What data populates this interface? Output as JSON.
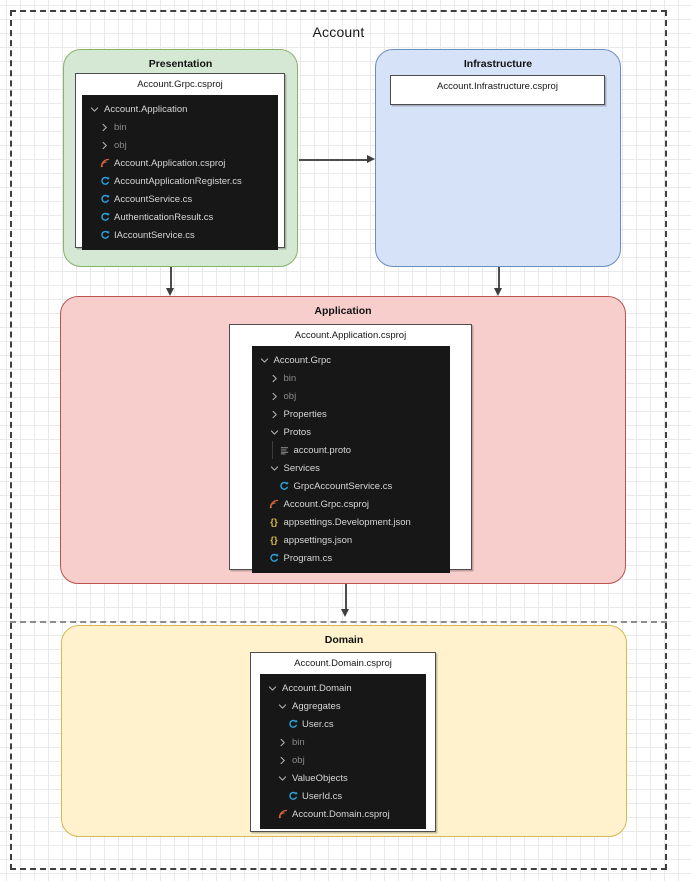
{
  "diagram": {
    "title": "Account",
    "layers": [
      {
        "id": "presentation",
        "label": "Presentation",
        "card_title": "Account.Grpc.csproj",
        "tree": [
          {
            "indent": 0,
            "icon": "chevron-down-icon",
            "label": "Account.Application",
            "dim": false
          },
          {
            "indent": 1,
            "icon": "chevron-right-icon",
            "label": "bin",
            "dim": true
          },
          {
            "indent": 1,
            "icon": "chevron-right-icon",
            "label": "obj",
            "dim": true
          },
          {
            "indent": 1,
            "icon": "csproj-icon",
            "label": "Account.Application.csproj",
            "dim": false
          },
          {
            "indent": 1,
            "icon": "csharp-icon",
            "label": "AccountApplicationRegister.cs",
            "dim": false
          },
          {
            "indent": 1,
            "icon": "csharp-icon",
            "label": "AccountService.cs",
            "dim": false
          },
          {
            "indent": 1,
            "icon": "csharp-icon",
            "label": "AuthenticationResult.cs",
            "dim": false
          },
          {
            "indent": 1,
            "icon": "csharp-icon",
            "label": "IAccountService.cs",
            "dim": false
          }
        ]
      },
      {
        "id": "infrastructure",
        "label": "Infrastructure",
        "card_title": "Account.Infrastructure.csproj",
        "tree": []
      },
      {
        "id": "application",
        "label": "Application",
        "card_title": "Account.Application.csproj",
        "tree": [
          {
            "indent": 0,
            "icon": "chevron-down-icon",
            "label": "Account.Grpc",
            "dim": false
          },
          {
            "indent": 1,
            "icon": "chevron-right-icon",
            "label": "bin",
            "dim": true
          },
          {
            "indent": 1,
            "icon": "chevron-right-icon",
            "label": "obj",
            "dim": true
          },
          {
            "indent": 1,
            "icon": "chevron-right-icon",
            "label": "Properties",
            "dim": false
          },
          {
            "indent": 1,
            "icon": "chevron-down-icon",
            "label": "Protos",
            "dim": false
          },
          {
            "indent": 2,
            "icon": "proto-icon",
            "label": "account.proto",
            "dim": false,
            "guide": true
          },
          {
            "indent": 1,
            "icon": "chevron-down-icon",
            "label": "Services",
            "dim": false
          },
          {
            "indent": 2,
            "icon": "csharp-icon",
            "label": "GrpcAccountService.cs",
            "dim": false
          },
          {
            "indent": 1,
            "icon": "csproj-icon",
            "label": "Account.Grpc.csproj",
            "dim": false
          },
          {
            "indent": 1,
            "icon": "json-icon",
            "label": "appsettings.Development.json",
            "dim": false
          },
          {
            "indent": 1,
            "icon": "json-icon",
            "label": "appsettings.json",
            "dim": false
          },
          {
            "indent": 1,
            "icon": "csharp-icon",
            "label": "Program.cs",
            "dim": false
          }
        ]
      },
      {
        "id": "domain",
        "label": "Domain",
        "card_title": "Account.Domain.csproj",
        "tree": [
          {
            "indent": 0,
            "icon": "chevron-down-icon",
            "label": "Account.Domain",
            "dim": false
          },
          {
            "indent": 1,
            "icon": "chevron-down-icon",
            "label": "Aggregates",
            "dim": false
          },
          {
            "indent": 2,
            "icon": "csharp-icon",
            "label": "User.cs",
            "dim": false
          },
          {
            "indent": 1,
            "icon": "chevron-right-icon",
            "label": "bin",
            "dim": true
          },
          {
            "indent": 1,
            "icon": "chevron-right-icon",
            "label": "obj",
            "dim": true
          },
          {
            "indent": 1,
            "icon": "chevron-down-icon",
            "label": "ValueObjects",
            "dim": false
          },
          {
            "indent": 2,
            "icon": "csharp-icon",
            "label": "UserId.cs",
            "dim": false
          },
          {
            "indent": 1,
            "icon": "csproj-icon",
            "label": "Account.Domain.csproj",
            "dim": false
          }
        ]
      }
    ],
    "connections": [
      {
        "from": "presentation",
        "to": "infrastructure",
        "direction": "right"
      },
      {
        "from": "presentation",
        "to": "application",
        "direction": "down"
      },
      {
        "from": "infrastructure",
        "to": "application",
        "direction": "down"
      },
      {
        "from": "application",
        "to": "domain",
        "direction": "down"
      }
    ],
    "colors": {
      "presentation_fill": "#d5e8d4",
      "presentation_stroke": "#86b36a",
      "infrastructure_fill": "#d5e2f7",
      "infrastructure_stroke": "#6c8ebf",
      "application_fill": "#f8cecc",
      "application_stroke": "#b85450",
      "domain_fill": "#fff2cc",
      "domain_stroke": "#d6b656",
      "tree_background": "#171717",
      "csharp_icon": "#2aa3df",
      "csproj_icon": "#d4653a",
      "json_icon": "#d7ba42",
      "proto_icon": "#9a9a9a"
    }
  }
}
